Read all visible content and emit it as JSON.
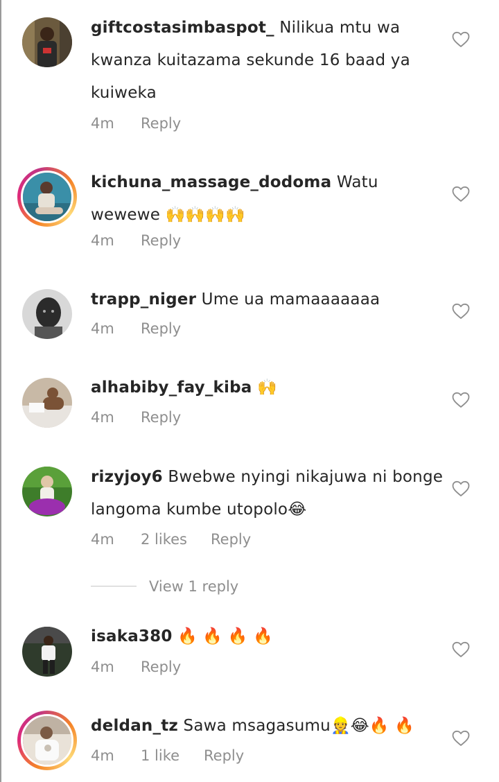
{
  "comments": [
    {
      "username": "giftcostasimbaspot_",
      "text": "Nilikua mtu wa kwanza kuitazama sekunde 16 baad ya kuiweka",
      "time": "4m",
      "likes": "",
      "reply_label": "Reply",
      "has_story": false,
      "avatar_colors": [
        "#6b5a3e",
        "#2a2a2a",
        "#c9a27a"
      ]
    },
    {
      "username": "kichuna_massage_dodoma",
      "text": "Watu wewewe 🙌🙌🙌🙌",
      "time": "4m",
      "likes": "",
      "reply_label": "Reply",
      "has_story": true,
      "avatar_colors": [
        "#3a8fa8",
        "#e7e1d6",
        "#5a3a2e"
      ]
    },
    {
      "username": "trapp_niger",
      "text": "Ume ua mamaaaaaaa",
      "time": "4m",
      "likes": "",
      "reply_label": "Reply",
      "has_story": false,
      "avatar_colors": [
        "#d8d8d8",
        "#2b2b2b",
        "#8a8a8a"
      ]
    },
    {
      "username": "alhabiby_fay_kiba",
      "text": "🙌",
      "time": "4m",
      "likes": "",
      "reply_label": "Reply",
      "has_story": false,
      "avatar_colors": [
        "#c8b9a6",
        "#7a5236",
        "#e8e4df"
      ]
    },
    {
      "username": "rizyjoy6",
      "text": "Bwebwe nyingi nikajuwa ni bonge langoma kumbe utopolo😂",
      "time": "4m",
      "likes": "2 likes",
      "reply_label": "Reply",
      "has_story": false,
      "avatar_colors": [
        "#3e7d2a",
        "#9b2fae",
        "#e0c7a8"
      ]
    },
    {
      "username": "isaka380",
      "text": "🔥 🔥 🔥 🔥",
      "time": "4m",
      "likes": "",
      "reply_label": "Reply",
      "has_story": false,
      "avatar_colors": [
        "#2f3b2c",
        "#f2f2f2",
        "#4a4a4a"
      ]
    },
    {
      "username": "deldan_tz",
      "text": "Sawa msagasumu👷😂🔥 🔥",
      "time": "4m",
      "likes": "1 like",
      "reply_label": "Reply",
      "has_story": true,
      "avatar_colors": [
        "#e9e2d8",
        "#7b5a44",
        "#bfb2a3"
      ]
    }
  ],
  "view_replies_label": "View 1 reply",
  "colors": {
    "text": "#262626",
    "meta": "#8e8e8e",
    "divider": "#c7c7c7"
  },
  "icons": {
    "like": "heart-outline-icon"
  }
}
